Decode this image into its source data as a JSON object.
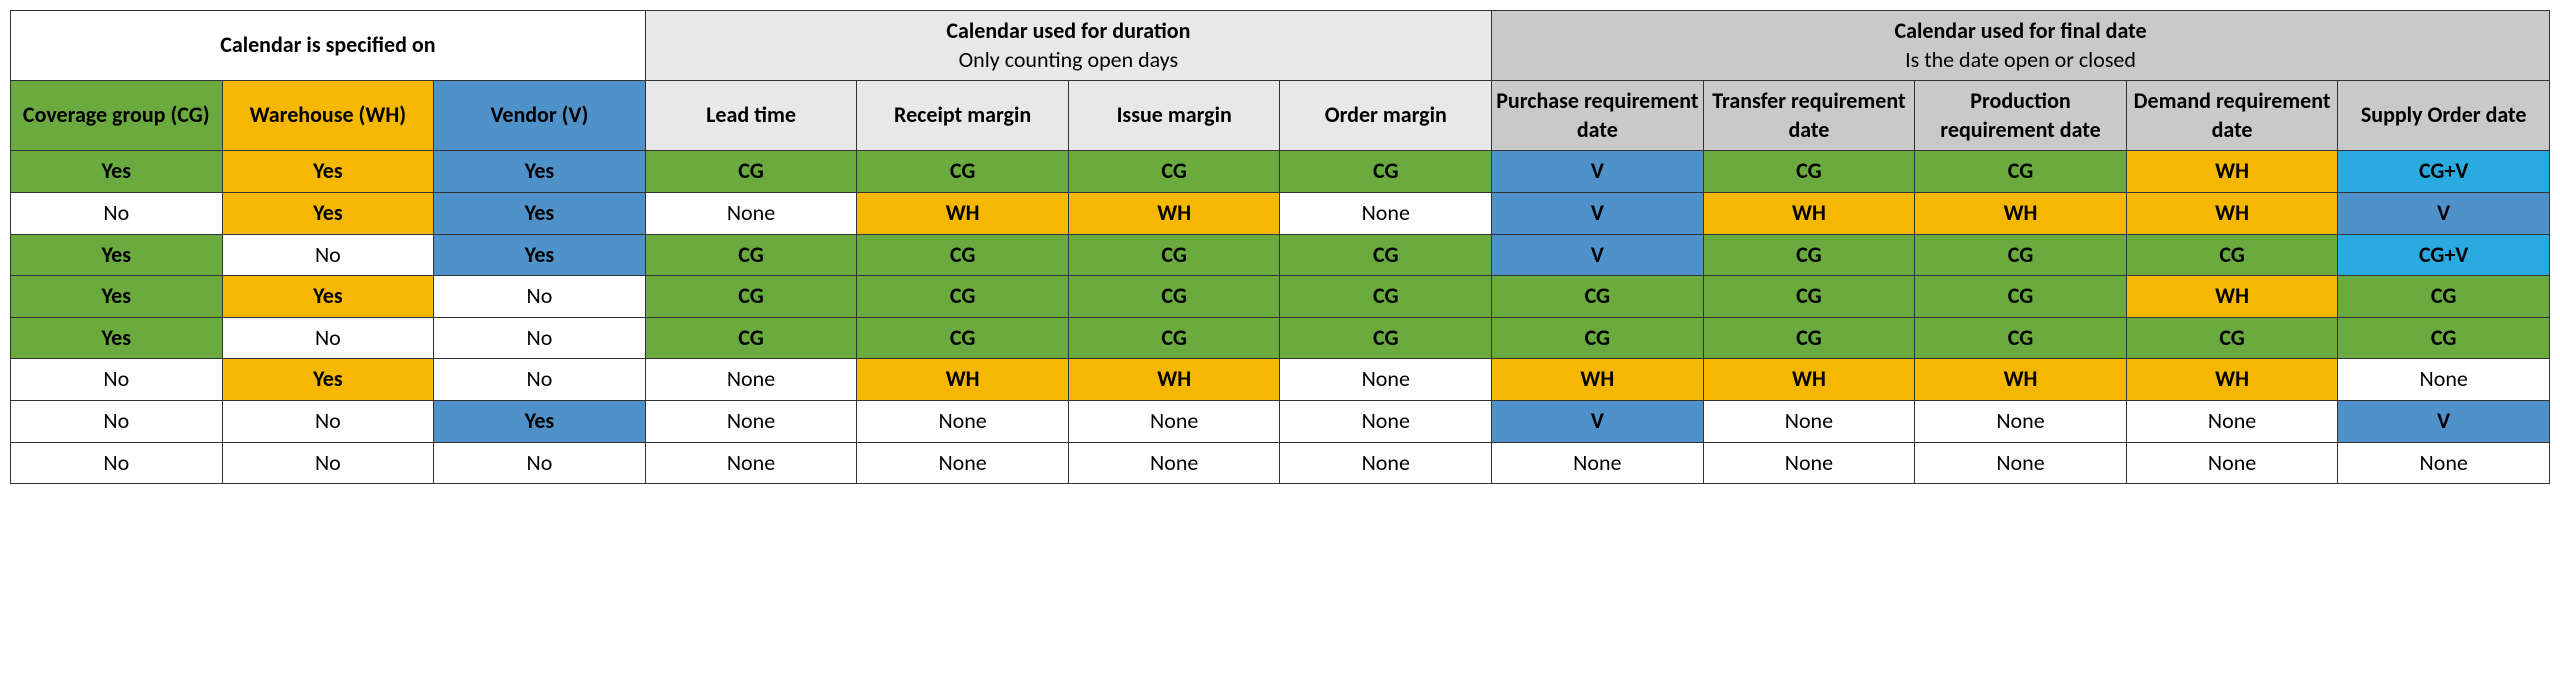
{
  "headers": {
    "spec": {
      "title": "Calendar is specified on"
    },
    "duration": {
      "title": "Calendar used for duration",
      "sub": "Only counting open days"
    },
    "final": {
      "title": "Calendar used for final date",
      "sub": "Is the date open or closed"
    },
    "cols": {
      "cg": "Coverage group (CG)",
      "wh": "Warehouse (WH)",
      "v": "Vendor (V)",
      "lead": "Lead time",
      "receipt": "Receipt margin",
      "issue": "Issue margin",
      "order": "Order margin",
      "purchase": "Purchase requirement date",
      "transfer": "Transfer requirement date",
      "production": "Production requirement date",
      "demand": "Demand requirement date",
      "supply": "Supply Order date"
    }
  },
  "chart_data": {
    "type": "table",
    "columns": [
      "Coverage group (CG)",
      "Warehouse (WH)",
      "Vendor (V)",
      "Lead time",
      "Receipt margin",
      "Issue margin",
      "Order margin",
      "Purchase requirement date",
      "Transfer requirement date",
      "Production requirement date",
      "Demand requirement date",
      "Supply Order date"
    ],
    "rows": [
      [
        "Yes",
        "Yes",
        "Yes",
        "CG",
        "CG",
        "CG",
        "CG",
        "V",
        "CG",
        "CG",
        "WH",
        "CG+V"
      ],
      [
        "No",
        "Yes",
        "Yes",
        "None",
        "WH",
        "WH",
        "None",
        "V",
        "WH",
        "WH",
        "WH",
        "V"
      ],
      [
        "Yes",
        "No",
        "Yes",
        "CG",
        "CG",
        "CG",
        "CG",
        "V",
        "CG",
        "CG",
        "CG",
        "CG+V"
      ],
      [
        "Yes",
        "Yes",
        "No",
        "CG",
        "CG",
        "CG",
        "CG",
        "CG",
        "CG",
        "CG",
        "WH",
        "CG"
      ],
      [
        "Yes",
        "No",
        "No",
        "CG",
        "CG",
        "CG",
        "CG",
        "CG",
        "CG",
        "CG",
        "CG",
        "CG"
      ],
      [
        "No",
        "Yes",
        "No",
        "None",
        "WH",
        "WH",
        "None",
        "WH",
        "WH",
        "WH",
        "WH",
        "None"
      ],
      [
        "No",
        "No",
        "Yes",
        "None",
        "None",
        "None",
        "None",
        "V",
        "None",
        "None",
        "None",
        "V"
      ],
      [
        "No",
        "No",
        "No",
        "None",
        "None",
        "None",
        "None",
        "None",
        "None",
        "None",
        "None",
        "None"
      ]
    ],
    "color_legend": {
      "CG": "green",
      "WH": "orange",
      "V": "blue",
      "CG+V": "cyan",
      "None": "plain",
      "No": "plain",
      "Yes": "contextual"
    }
  },
  "rows": [
    [
      {
        "v": "Yes",
        "c": "green"
      },
      {
        "v": "Yes",
        "c": "orange"
      },
      {
        "v": "Yes",
        "c": "blue"
      },
      {
        "v": "CG",
        "c": "green"
      },
      {
        "v": "CG",
        "c": "green"
      },
      {
        "v": "CG",
        "c": "green"
      },
      {
        "v": "CG",
        "c": "green"
      },
      {
        "v": "V",
        "c": "blue"
      },
      {
        "v": "CG",
        "c": "green"
      },
      {
        "v": "CG",
        "c": "green"
      },
      {
        "v": "WH",
        "c": "orange"
      },
      {
        "v": "CG+V",
        "c": "cyan"
      }
    ],
    [
      {
        "v": "No",
        "c": "plain"
      },
      {
        "v": "Yes",
        "c": "orange"
      },
      {
        "v": "Yes",
        "c": "blue"
      },
      {
        "v": "None",
        "c": "plain"
      },
      {
        "v": "WH",
        "c": "orange"
      },
      {
        "v": "WH",
        "c": "orange"
      },
      {
        "v": "None",
        "c": "plain"
      },
      {
        "v": "V",
        "c": "blue"
      },
      {
        "v": "WH",
        "c": "orange"
      },
      {
        "v": "WH",
        "c": "orange"
      },
      {
        "v": "WH",
        "c": "orange"
      },
      {
        "v": "V",
        "c": "blue"
      }
    ],
    [
      {
        "v": "Yes",
        "c": "green"
      },
      {
        "v": "No",
        "c": "plain"
      },
      {
        "v": "Yes",
        "c": "blue"
      },
      {
        "v": "CG",
        "c": "green"
      },
      {
        "v": "CG",
        "c": "green"
      },
      {
        "v": "CG",
        "c": "green"
      },
      {
        "v": "CG",
        "c": "green"
      },
      {
        "v": "V",
        "c": "blue"
      },
      {
        "v": "CG",
        "c": "green"
      },
      {
        "v": "CG",
        "c": "green"
      },
      {
        "v": "CG",
        "c": "green"
      },
      {
        "v": "CG+V",
        "c": "cyan"
      }
    ],
    [
      {
        "v": "Yes",
        "c": "green"
      },
      {
        "v": "Yes",
        "c": "orange"
      },
      {
        "v": "No",
        "c": "plain"
      },
      {
        "v": "CG",
        "c": "green"
      },
      {
        "v": "CG",
        "c": "green"
      },
      {
        "v": "CG",
        "c": "green"
      },
      {
        "v": "CG",
        "c": "green"
      },
      {
        "v": "CG",
        "c": "green"
      },
      {
        "v": "CG",
        "c": "green"
      },
      {
        "v": "CG",
        "c": "green"
      },
      {
        "v": "WH",
        "c": "orange"
      },
      {
        "v": "CG",
        "c": "green"
      }
    ],
    [
      {
        "v": "Yes",
        "c": "green"
      },
      {
        "v": "No",
        "c": "plain"
      },
      {
        "v": "No",
        "c": "plain"
      },
      {
        "v": "CG",
        "c": "green"
      },
      {
        "v": "CG",
        "c": "green"
      },
      {
        "v": "CG",
        "c": "green"
      },
      {
        "v": "CG",
        "c": "green"
      },
      {
        "v": "CG",
        "c": "green"
      },
      {
        "v": "CG",
        "c": "green"
      },
      {
        "v": "CG",
        "c": "green"
      },
      {
        "v": "CG",
        "c": "green"
      },
      {
        "v": "CG",
        "c": "green"
      }
    ],
    [
      {
        "v": "No",
        "c": "plain"
      },
      {
        "v": "Yes",
        "c": "orange"
      },
      {
        "v": "No",
        "c": "plain"
      },
      {
        "v": "None",
        "c": "plain"
      },
      {
        "v": "WH",
        "c": "orange"
      },
      {
        "v": "WH",
        "c": "orange"
      },
      {
        "v": "None",
        "c": "plain"
      },
      {
        "v": "WH",
        "c": "orange"
      },
      {
        "v": "WH",
        "c": "orange"
      },
      {
        "v": "WH",
        "c": "orange"
      },
      {
        "v": "WH",
        "c": "orange"
      },
      {
        "v": "None",
        "c": "plain"
      }
    ],
    [
      {
        "v": "No",
        "c": "plain"
      },
      {
        "v": "No",
        "c": "plain"
      },
      {
        "v": "Yes",
        "c": "blue"
      },
      {
        "v": "None",
        "c": "plain"
      },
      {
        "v": "None",
        "c": "plain"
      },
      {
        "v": "None",
        "c": "plain"
      },
      {
        "v": "None",
        "c": "plain"
      },
      {
        "v": "V",
        "c": "blue"
      },
      {
        "v": "None",
        "c": "plain"
      },
      {
        "v": "None",
        "c": "plain"
      },
      {
        "v": "None",
        "c": "plain"
      },
      {
        "v": "V",
        "c": "blue"
      }
    ],
    [
      {
        "v": "No",
        "c": "plain"
      },
      {
        "v": "No",
        "c": "plain"
      },
      {
        "v": "No",
        "c": "plain"
      },
      {
        "v": "None",
        "c": "plain"
      },
      {
        "v": "None",
        "c": "plain"
      },
      {
        "v": "None",
        "c": "plain"
      },
      {
        "v": "None",
        "c": "plain"
      },
      {
        "v": "None",
        "c": "plain"
      },
      {
        "v": "None",
        "c": "plain"
      },
      {
        "v": "None",
        "c": "plain"
      },
      {
        "v": "None",
        "c": "plain"
      },
      {
        "v": "None",
        "c": "plain"
      }
    ]
  ]
}
